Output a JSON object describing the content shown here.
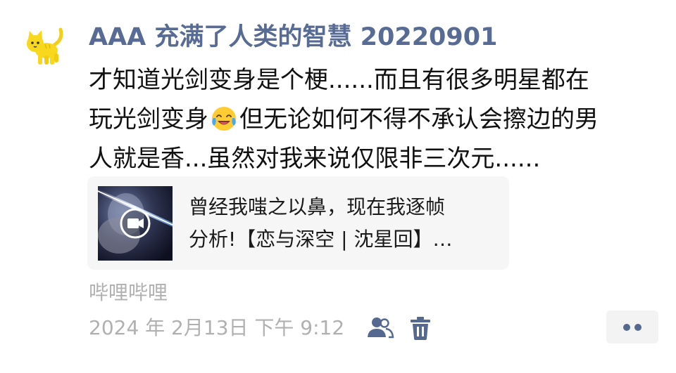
{
  "user": {
    "name": "AAA 充满了人类的智慧 20220901",
    "avatar_icon": "yellow-cat-icon"
  },
  "post": {
    "lines": [
      "才知道光剑变身是个梗......而且有很多明星都在",
      "玩光剑变身",
      "但无论如何不得不承认会擦边的男",
      "人就是香...虽然对我来说仅限非三次元......"
    ],
    "emoji": "laughing-crying-face-icon"
  },
  "share_card": {
    "title_line1": "曾经我嗤之以鼻，现在我逐帧",
    "title_line2": "分析!【恋与深空 | 沈星回】…",
    "thumbnail_icon": "video-play-icon"
  },
  "source": "哔哩哔哩",
  "meta": {
    "timestamp": "2024 年 2月13日 下午 9:12",
    "visibility_icon": "people-icon",
    "delete_icon": "trash-icon",
    "more_icon": "more-dots-icon"
  },
  "colors": {
    "username": "#586b95",
    "meta_text": "#b0b0b0",
    "card_bg": "#f6f6f6",
    "icon_blue": "#55688f"
  }
}
